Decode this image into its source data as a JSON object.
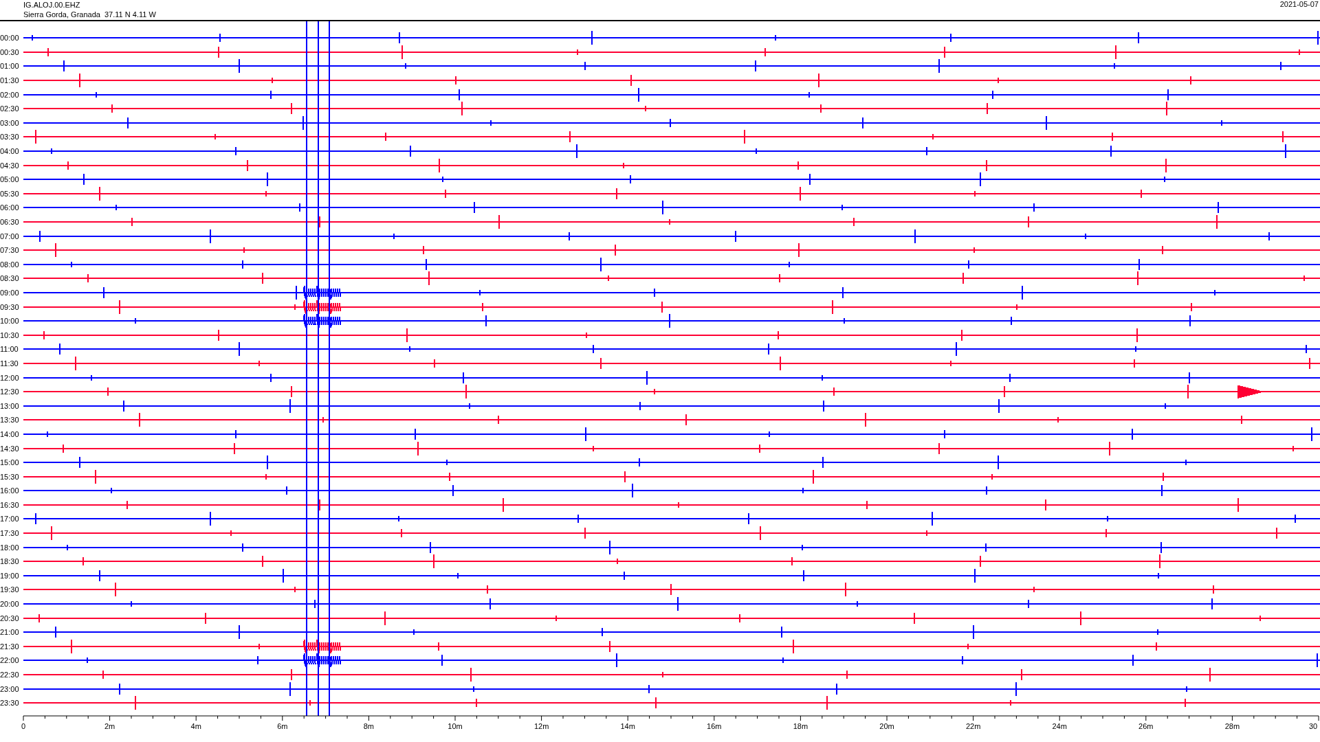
{
  "header": {
    "station": "IG.ALOJ.00.EHZ",
    "location": "Sierra Gorda, Granada  37.11 N 4.11 W",
    "date": "2021-05-07"
  },
  "traces": [
    {
      "time": "00:00",
      "color": "#0000ff"
    },
    {
      "time": "00:30",
      "color": "#ff0033"
    },
    {
      "time": "01:00",
      "color": "#0000ff"
    },
    {
      "time": "01:30",
      "color": "#ff0033"
    },
    {
      "time": "02:00",
      "color": "#0000ff"
    },
    {
      "time": "02:30",
      "color": "#ff0033"
    },
    {
      "time": "03:00",
      "color": "#0000ff"
    },
    {
      "time": "03:30",
      "color": "#ff0033"
    },
    {
      "time": "04:00",
      "color": "#0000ff"
    },
    {
      "time": "04:30",
      "color": "#ff0033"
    },
    {
      "time": "05:00",
      "color": "#0000ff"
    },
    {
      "time": "05:30",
      "color": "#ff0033"
    },
    {
      "time": "06:00",
      "color": "#0000ff"
    },
    {
      "time": "06:30",
      "color": "#ff0033"
    },
    {
      "time": "07:00",
      "color": "#0000ff"
    },
    {
      "time": "07:30",
      "color": "#ff0033"
    },
    {
      "time": "08:00",
      "color": "#0000ff"
    },
    {
      "time": "08:30",
      "color": "#ff0033"
    },
    {
      "time": "09:00",
      "color": "#0000ff"
    },
    {
      "time": "09:30",
      "color": "#ff0033"
    },
    {
      "time": "10:00",
      "color": "#0000ff"
    },
    {
      "time": "10:30",
      "color": "#ff0033"
    },
    {
      "time": "11:00",
      "color": "#0000ff"
    },
    {
      "time": "11:30",
      "color": "#ff0033"
    },
    {
      "time": "12:00",
      "color": "#0000ff"
    },
    {
      "time": "12:30",
      "color": "#ff0033"
    },
    {
      "time": "13:00",
      "color": "#0000ff"
    },
    {
      "time": "13:30",
      "color": "#ff0033"
    },
    {
      "time": "14:00",
      "color": "#0000ff"
    },
    {
      "time": "14:30",
      "color": "#ff0033"
    },
    {
      "time": "15:00",
      "color": "#0000ff"
    },
    {
      "time": "15:30",
      "color": "#ff0033"
    },
    {
      "time": "16:00",
      "color": "#0000ff"
    },
    {
      "time": "16:30",
      "color": "#ff0033"
    },
    {
      "time": "17:00",
      "color": "#0000ff"
    },
    {
      "time": "17:30",
      "color": "#ff0033"
    },
    {
      "time": "18:00",
      "color": "#0000ff"
    },
    {
      "time": "18:30",
      "color": "#ff0033"
    },
    {
      "time": "19:00",
      "color": "#0000ff"
    },
    {
      "time": "19:30",
      "color": "#ff0033"
    },
    {
      "time": "20:00",
      "color": "#0000ff"
    },
    {
      "time": "20:30",
      "color": "#ff0033"
    },
    {
      "time": "21:00",
      "color": "#0000ff"
    },
    {
      "time": "21:30",
      "color": "#ff0033"
    },
    {
      "time": "22:00",
      "color": "#0000ff"
    },
    {
      "time": "22:30",
      "color": "#ff0033"
    },
    {
      "time": "23:00",
      "color": "#0000ff"
    },
    {
      "time": "23:30",
      "color": "#ff0033"
    }
  ],
  "axis_labels": [
    "0",
    "2m",
    "4m",
    "6m",
    "8m",
    "10m",
    "12m",
    "14m",
    "16m",
    "18m",
    "20m",
    "22m",
    "24m",
    "26m",
    "28m",
    "30"
  ]
}
